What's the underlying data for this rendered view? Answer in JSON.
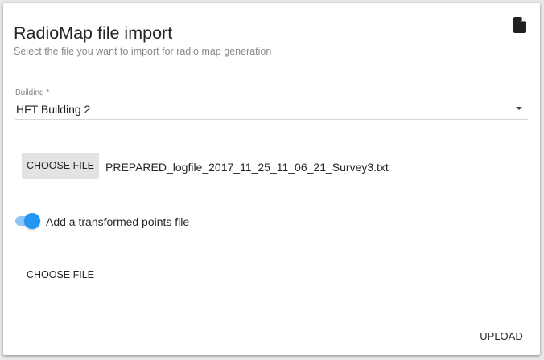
{
  "dialog": {
    "title": "RadioMap file import",
    "subtitle": "Select the file you want to import for radio map generation",
    "header_icon": "file-icon"
  },
  "building_select": {
    "label": "Building *",
    "value": "HFT Building 2"
  },
  "log_file": {
    "button_label": "CHOOSE FILE",
    "file_name": "PREPARED_logfile_2017_11_25_11_06_21_Survey3.txt"
  },
  "transformed_toggle": {
    "label": "Add a transformed points file",
    "checked": true,
    "color": "#2196f3"
  },
  "transformed_file": {
    "button_label": "CHOOSE FILE"
  },
  "actions": {
    "upload_label": "UPLOAD"
  }
}
